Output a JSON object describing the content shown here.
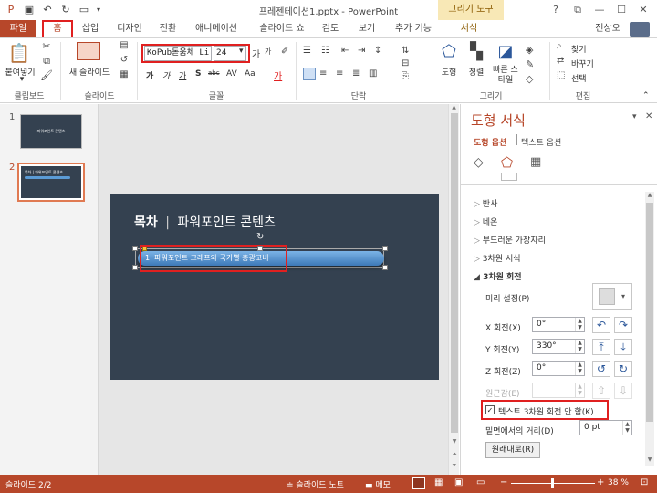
{
  "titlebar": {
    "title": "프레젠테이션1.pptx - PowerPoint",
    "contextual_tab": "그리기 도구",
    "window_controls": [
      "?",
      "⧉",
      "—",
      "☐",
      "✕"
    ]
  },
  "tabs": {
    "file": "파일",
    "home": "홈",
    "items": [
      "삽입",
      "디자인",
      "전환",
      "애니메이션",
      "슬라이드 쇼",
      "검토",
      "보기",
      "추가 기능",
      "서식"
    ],
    "user": "전상오"
  },
  "ribbon": {
    "clipboard": {
      "paste": "붙여넣기",
      "label": "클립보드"
    },
    "slides": {
      "new_slide": "새 슬라이드",
      "label": "슬라이드"
    },
    "font": {
      "name": "KoPub돋움체 Li",
      "size": "24",
      "label": "글꼴"
    },
    "paragraph": {
      "label": "단락"
    },
    "drawing": {
      "shape": "도형",
      "arrange": "정렬",
      "quick_styles": "빠른 스타일",
      "label": "그리기"
    },
    "editing": {
      "find": "찾기",
      "replace": "바꾸기",
      "select": "선택",
      "label": "편집"
    }
  },
  "slides": [
    {
      "number": "1",
      "title": "파워포인트 콘텐츠"
    },
    {
      "number": "2",
      "title": "목차 | 파워포인트 콘텐츠"
    }
  ],
  "slide": {
    "title_bold": "목차",
    "title_sep": "|",
    "title_rest": "파워포인트 콘텐츠",
    "item": "1. 파워포인트 그래프와 국가별 총광고비"
  },
  "format_pane": {
    "title": "도형 서식",
    "tab_shape": "도형 옵션",
    "tab_text": "텍스트 옵션",
    "sections": [
      "반사",
      "네온",
      "부드러운 가장자리",
      "3차원 서식",
      "3차원 회전"
    ],
    "preset_label": "미리 설정(P)",
    "x_label": "X 회전(X)",
    "x_value": "0°",
    "y_label": "Y 회전(Y)",
    "y_value": "330°",
    "z_label": "Z 회전(Z)",
    "z_value": "0°",
    "perspective_label": "원근감(E)",
    "keep_text_flat": "텍스트 3차원 회전 안 함(K)",
    "distance_label": "밑면에서의 거리(D)",
    "distance_value": "0 pt",
    "reset_button": "원래대로(R)"
  },
  "status": {
    "slide_info": "슬라이드 2/2",
    "notes": "슬라이드 노트",
    "comments": "메모",
    "zoom": "38 %"
  }
}
